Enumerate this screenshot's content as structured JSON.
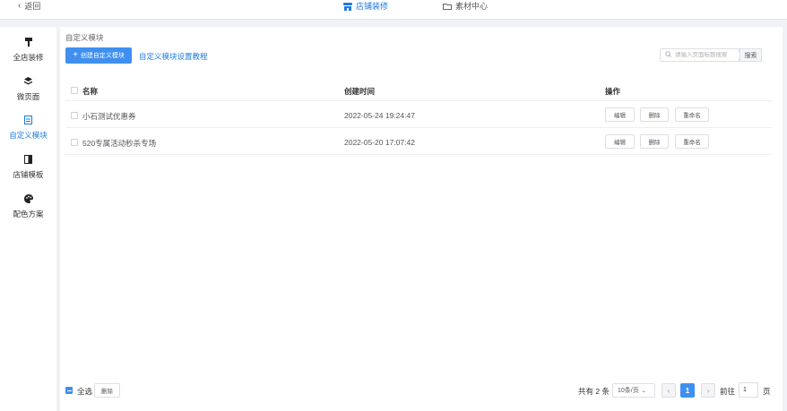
{
  "topbar": {
    "back_label": "返回",
    "tabs": [
      {
        "label": "店铺装修",
        "icon": "shop-icon",
        "active": true
      },
      {
        "label": "素材中心",
        "icon": "folder-icon",
        "active": false
      }
    ]
  },
  "sidebar": {
    "items": [
      {
        "label": "全店装修",
        "icon": "paint-roller-icon"
      },
      {
        "label": "微页面",
        "icon": "layers-icon"
      },
      {
        "label": "自定义模块",
        "icon": "module-icon",
        "active": true
      },
      {
        "label": "店铺模板",
        "icon": "template-icon"
      },
      {
        "label": "配色方案",
        "icon": "palette-icon"
      }
    ]
  },
  "main": {
    "breadcrumb": "自定义模块",
    "create_button": "创建自定义模块",
    "tutorial_link": "自定义模块设置教程",
    "search": {
      "placeholder": "请输入页面标题搜索",
      "button": "搜索",
      "value": ""
    },
    "table": {
      "headers": {
        "name": "名称",
        "created": "创建时间",
        "ops": "操作"
      },
      "rows": [
        {
          "name": "小石测试优惠券",
          "created": "2022-05-24 19:24:47"
        },
        {
          "name": "520专属活动秒杀专场",
          "created": "2022-05-20 17:07:42"
        }
      ],
      "row_actions": {
        "edit": "编辑",
        "delete": "删除",
        "rename": "重命名"
      }
    },
    "footer": {
      "select_all": "全选",
      "bulk_delete": "删除",
      "total": "共有 2 条",
      "page_size": "10条/页",
      "current_page": "1",
      "goto_label": "前往",
      "goto_value": "1",
      "page_unit": "页"
    }
  },
  "colors": {
    "accent": "#3f8ff0",
    "link": "#1f7ae0",
    "background": "#f0f2f5"
  }
}
